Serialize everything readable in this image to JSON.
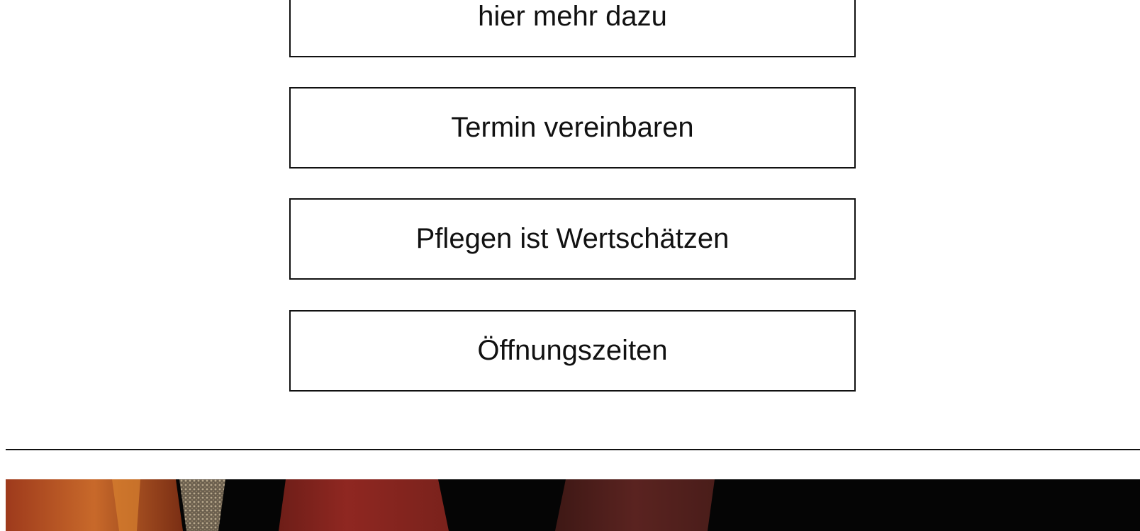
{
  "nav_buttons": [
    {
      "label": "hier mehr dazu"
    },
    {
      "label": "Termin vereinbaren"
    },
    {
      "label": "Pflegen ist Wertschätzen"
    },
    {
      "label": "Öffnungszeiten"
    }
  ],
  "banner": {
    "colors": {
      "background": "#050505",
      "orange": "#c8692a",
      "red": "#8f2721",
      "dark_red": "#5a2320",
      "texture": "#9a8a72"
    }
  }
}
